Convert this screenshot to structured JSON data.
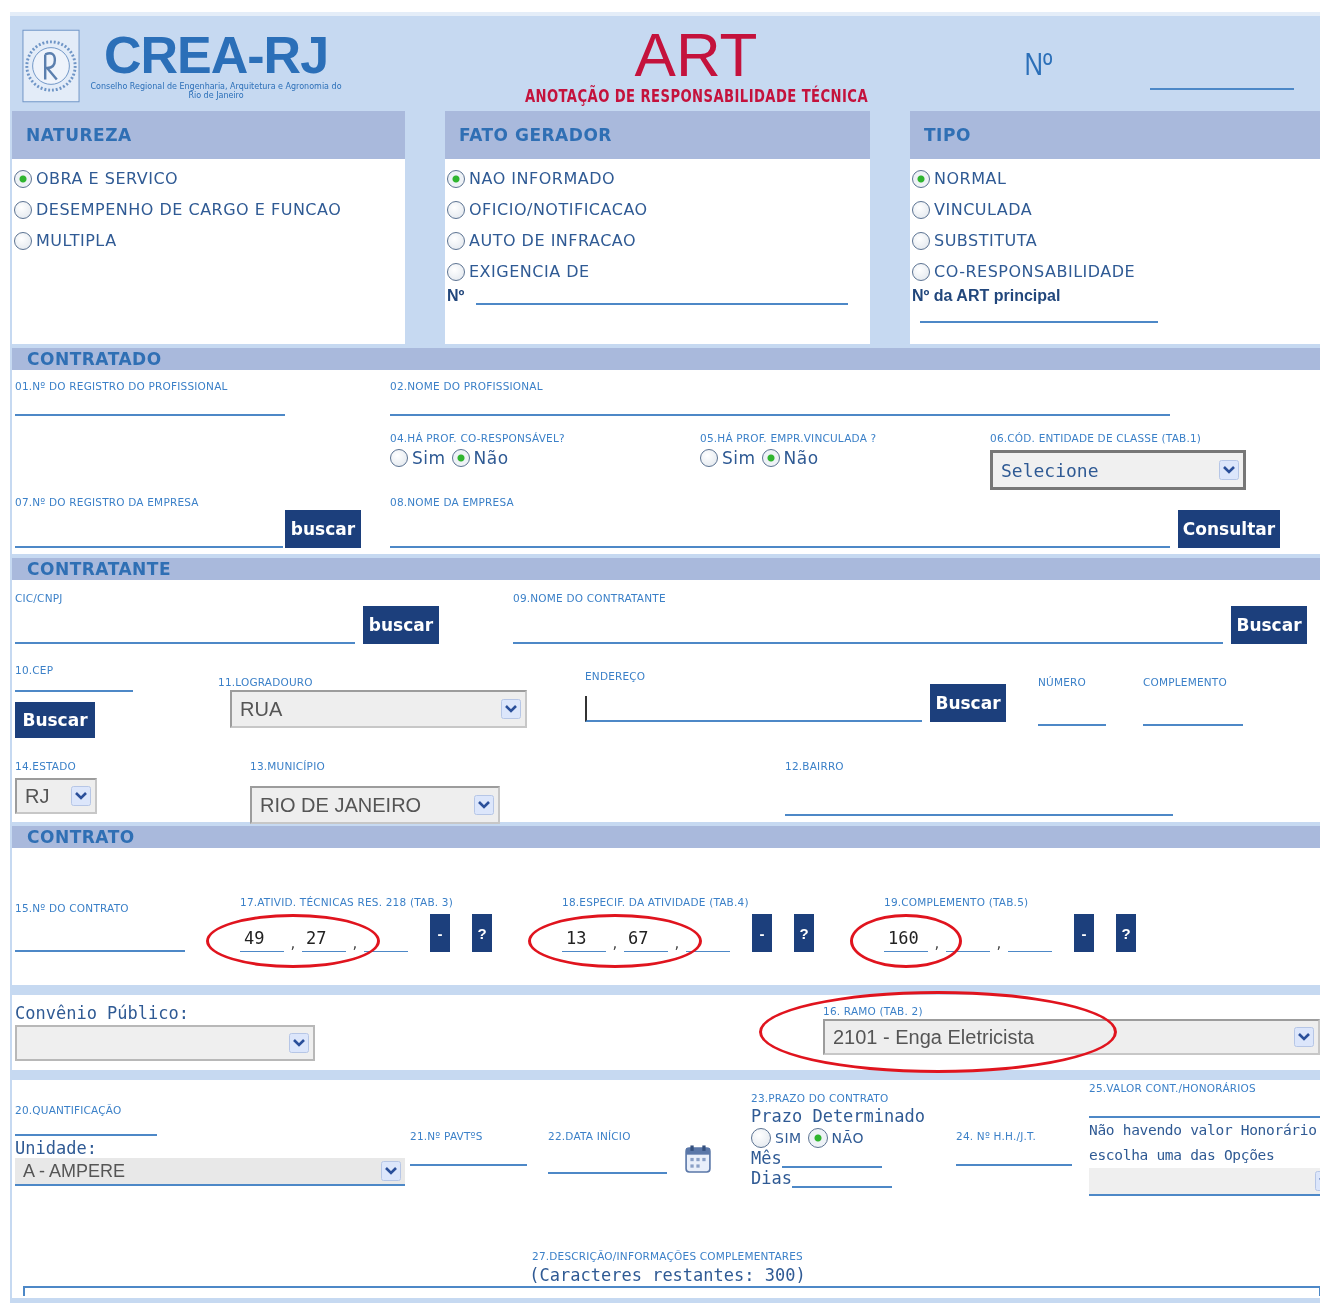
{
  "header": {
    "org": "CREA-RJ",
    "org_tagline": "Conselho Regional de Engenharia, Arquitetura e Agronomia do Rio de Janeiro",
    "title": "ART",
    "subtitle": "ANOTAÇÃO DE RESPONSABILIDADE TÉCNICA",
    "number_label": "Nº"
  },
  "groups": [
    {
      "title": "NATUREZA",
      "options": [
        {
          "label": "OBRA E SERVICO",
          "selected": true
        },
        {
          "label": "DESEMPENHO DE CARGO E FUNCAO",
          "selected": false
        },
        {
          "label": "MULTIPLA",
          "selected": false
        }
      ]
    },
    {
      "title": "FATO GERADOR",
      "options": [
        {
          "label": "NAO INFORMADO",
          "selected": true
        },
        {
          "label": "OFICIO/NOTIFICACAO",
          "selected": false
        },
        {
          "label": "AUTO DE INFRACAO",
          "selected": false
        },
        {
          "label": "EXIGENCIA DE",
          "selected": false
        }
      ],
      "number_label": "Nº"
    },
    {
      "title": "TIPO",
      "options": [
        {
          "label": "NORMAL",
          "selected": true
        },
        {
          "label": "VINCULADA",
          "selected": false
        },
        {
          "label": "SUBSTITUTA",
          "selected": false
        },
        {
          "label": "CO-RESPONSABILIDADE",
          "selected": false
        }
      ],
      "number_label": "Nº da ART principal"
    }
  ],
  "contratado": {
    "title": "CONTRATADO",
    "registro_label": "01.Nº DO REGISTRO DO PROFISSIONAL",
    "nome_label": "02.NOME DO PROFISSIONAL",
    "co_responsavel": {
      "label": "04.HÁ PROF. CO-RESPONSÁVEL?",
      "options": [
        {
          "label": "Sim",
          "selected": false
        },
        {
          "label": "Não",
          "selected": true
        }
      ]
    },
    "vinculada": {
      "label": "05.HÁ PROF. EMPR.VINCULADA ?",
      "options": [
        {
          "label": "Sim",
          "selected": false
        },
        {
          "label": "Não",
          "selected": true
        }
      ]
    },
    "entidade": {
      "label": "06.CÓD. ENTIDADE DE CLASSE (TAB.1)",
      "value": "Selecione"
    },
    "empresa_registro_label": "07.Nº DO REGISTRO DA EMPRESA",
    "empresa_button": "buscar",
    "empresa_nome_label": "08.NOME DA EMPRESA",
    "consult_button": "Consultar"
  },
  "contratante": {
    "title": "CONTRATANTE",
    "cnpj_label": "CIC/CNPJ",
    "cnpj_button": "buscar",
    "nome_label": "09.NOME DO CONTRATANTE",
    "nome_button": "Buscar",
    "cep_label": "10.CEP",
    "cep_button": "Buscar",
    "logradouro": {
      "label": "11.LOGRADOURO",
      "value": "RUA"
    },
    "endereco_label": "ENDEREÇO",
    "endereco_button": "Buscar",
    "numero_label": "NÚMERO",
    "complemento_label": "COMPLEMENTO",
    "estado": {
      "label": "14.ESTADO",
      "value": "RJ"
    },
    "municipio": {
      "label": "13.MUNICÍPIO",
      "value": "RIO DE JANEIRO"
    },
    "bairro_label": "12.BAIRRO"
  },
  "contrato": {
    "title": "CONTRATO",
    "numero_label": "15.Nº DO CONTRATO",
    "separator": ",",
    "buttons": [
      "-",
      "?"
    ],
    "activities": [
      {
        "label": "17.ATIVID. TÉCNICAS RES. 218 (TAB. 3)",
        "parts": [
          {
            "value": "49",
            "circled": true
          },
          {
            "value": "27",
            "circled": true
          },
          {
            "circled": false
          }
        ]
      },
      {
        "label": "18.ESPECIF. DA ATIVIDADE (TAB.4)",
        "parts": [
          {
            "value": "13",
            "circled": true
          },
          {
            "value": "67",
            "circled": true
          },
          {
            "circled": false
          }
        ]
      },
      {
        "label": "19.COMPLEMENTO (TAB.5)",
        "parts": [
          {
            "value": "160",
            "circled": true
          },
          {
            "circled": false
          },
          {
            "circled": false
          }
        ]
      }
    ]
  },
  "convenio": {
    "label": "Convênio Público:"
  },
  "ramo": {
    "label": "16. RAMO (TAB. 2)",
    "value": "2101 - Enga Eletricista",
    "circled": true
  },
  "detalhes": {
    "quantificacao_label": "20.QUANTIFICAÇÃO",
    "unidade_label": "Unidade:",
    "unidade_value": "A - AMPERE",
    "pavtos_label": "21.Nº PAVTºS",
    "data_label": "22.DATA INÍCIO",
    "prazo": {
      "label": "23.PRAZO DO CONTRATO",
      "text": "Prazo Determinado",
      "options": [
        {
          "label": "SIM",
          "selected": false
        },
        {
          "label": "NÃO",
          "selected": true
        }
      ],
      "mes_label": "Mês",
      "dias_label": "Dias"
    },
    "hh_label": "24. Nº H.H./J.T.",
    "valor_label": "25.VALOR CONT./HONORÁRIOS",
    "valor_note": "Não havendo valor Honorário escolha uma das Opções",
    "descricao_label": "27.DESCRIÇÃO/INFORMAÇÕES COMPLEMENTARES",
    "descricao_counter": "(Caracteres restantes: 300)"
  }
}
